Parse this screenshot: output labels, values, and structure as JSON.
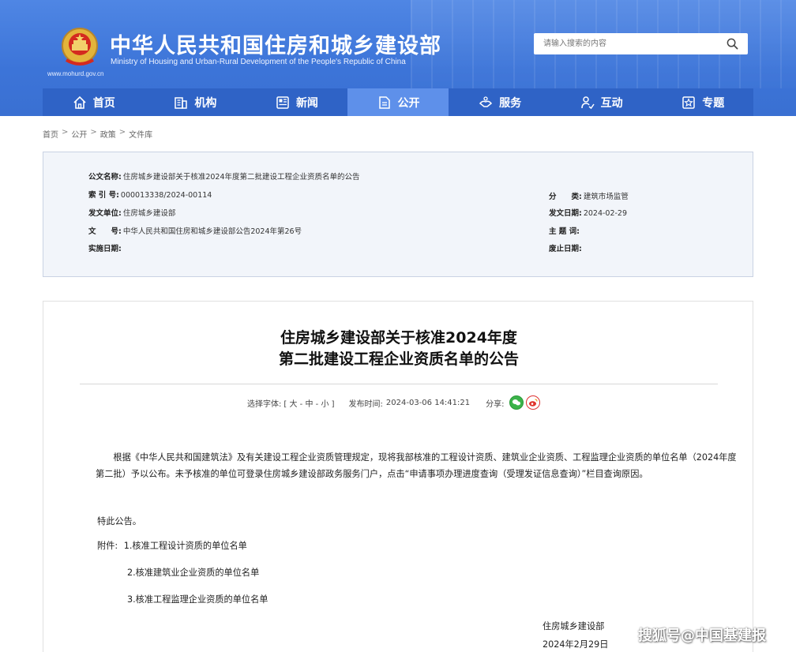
{
  "header": {
    "site_title": "中华人民共和国住房和城乡建设部",
    "site_subtitle": "Ministry of Housing and Urban-Rural Development of the People's Republic of China",
    "site_url": "www.mohurd.gov.cn",
    "search_placeholder": "请输入搜索的内容",
    "search_icon": "search-icon"
  },
  "nav": {
    "items": [
      {
        "label": "首页",
        "icon": "home-icon"
      },
      {
        "label": "机构",
        "icon": "building-icon"
      },
      {
        "label": "新闻",
        "icon": "news-icon"
      },
      {
        "label": "公开",
        "icon": "document-icon"
      },
      {
        "label": "服务",
        "icon": "service-icon"
      },
      {
        "label": "互动",
        "icon": "user-interact-icon"
      },
      {
        "label": "专题",
        "icon": "topic-icon"
      }
    ],
    "active_index": 3
  },
  "breadcrumb": {
    "items": [
      "首页",
      "公开",
      "政策",
      "文件库"
    ],
    "separator": ">"
  },
  "info": {
    "doc_name_label": "公文名称:",
    "doc_name": "住房城乡建设部关于核准2024年度第二批建设工程企业资质名单的公告",
    "index_label": "索 引 号:",
    "index_no": "000013338/2024-00114",
    "category_label": "分　　类:",
    "category": "建筑市场监管",
    "issuer_label": "发文单位:",
    "issuer": "住房城乡建设部",
    "issue_date_label": "发文日期:",
    "issue_date": "2024-02-29",
    "docno_label": "文　　号:",
    "doc_no": "中华人民共和国住房和城乡建设部公告2024年第26号",
    "subject_label": "主 题 词:",
    "subject": "",
    "effective_label": "实施日期:",
    "effective": "",
    "expire_label": "废止日期:",
    "expire": ""
  },
  "article": {
    "title_line1": "住房城乡建设部关于核准2024年度",
    "title_line2": "第二批建设工程企业资质名单的公告",
    "font_size_label": "选择字体:",
    "font_open": "[",
    "font_big": "大",
    "font_mid": "中",
    "font_small": "小",
    "font_dash": "-",
    "font_close": "]",
    "publish_label": "发布时间:",
    "publish_time": "2024-03-06 14:41:21",
    "share_label": "分享:",
    "paragraph1": "根据《中华人民共和国建筑法》及有关建设工程企业资质管理规定，现将我部核准的工程设计资质、建筑业企业资质、工程监理企业资质的单位名单（2024年度第二批）予以公布。未予核准的单位可登录住房城乡建设部政务服务门户，点击“申请事项办理进度查询（受理发证信息查询）”栏目查询原因。",
    "announce": "特此公告。",
    "attachment_label": "附件:",
    "attachments": [
      "1.核准工程设计资质的单位名单",
      "2.核准建筑业企业资质的单位名单",
      "3.核准工程监理企业资质的单位名单"
    ],
    "signer": "住房城乡建设部",
    "sign_date": "2024年2月29日"
  },
  "watermark": "搜狐号@中国基建报",
  "colors": {
    "header_blue": "#3c74d8",
    "nav_blue": "#2f63c6",
    "nav_active": "#5e90ea",
    "info_bg": "#f2f5fa"
  }
}
